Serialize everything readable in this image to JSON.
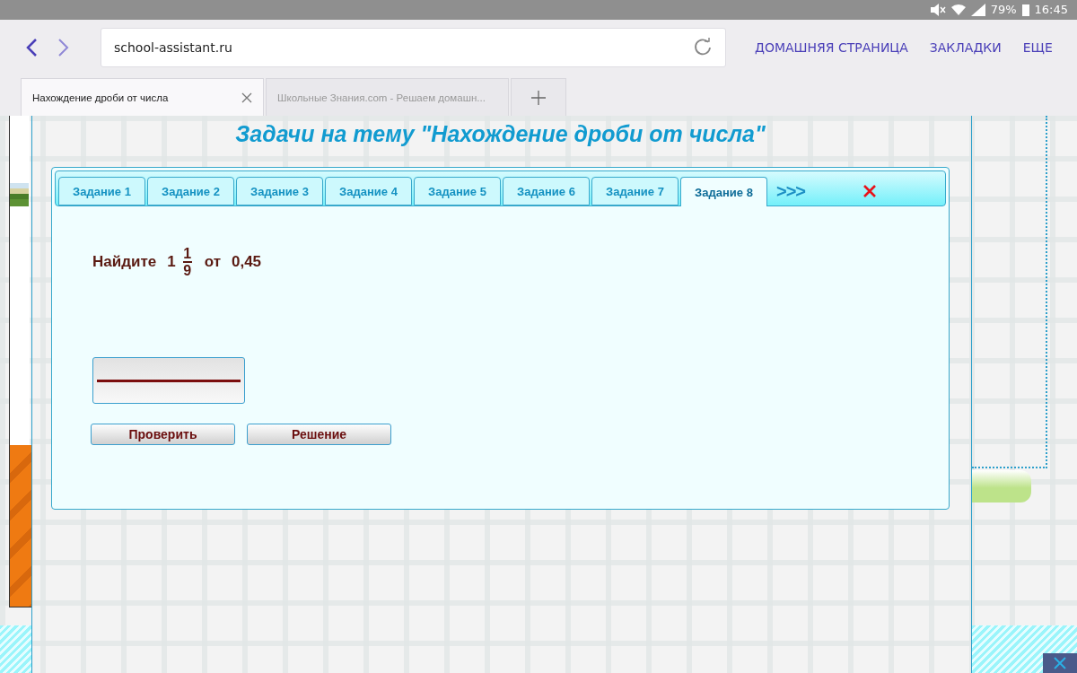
{
  "status_bar": {
    "battery": "79%",
    "time": "16:45"
  },
  "browser": {
    "url": "school-assistant.ru",
    "nav_links": [
      "ДОМАШНЯЯ СТРАНИЦА",
      "ЗАКЛАДКИ",
      "ЕЩЕ"
    ],
    "tabs": [
      {
        "title": "Нахождение дроби от числа",
        "selected": true
      },
      {
        "title": "Школьные Знания.com - Решаем домашн...",
        "selected": false
      }
    ]
  },
  "page": {
    "title": "Задачи на тему \"Нахождение дроби от числа\"",
    "task_tabs": [
      {
        "label": "Задание 1",
        "selected": false
      },
      {
        "label": "Задание 2",
        "selected": false
      },
      {
        "label": "Задание 3",
        "selected": false
      },
      {
        "label": "Задание 4",
        "selected": false
      },
      {
        "label": "Задание 5",
        "selected": false
      },
      {
        "label": "Задание 6",
        "selected": false
      },
      {
        "label": "Задание 7",
        "selected": false
      },
      {
        "label": "Задание 8",
        "selected": true
      }
    ],
    "more_label": ">>>",
    "problem": {
      "prefix": "Найдите",
      "whole": "1",
      "numerator": "1",
      "denominator": "9",
      "middle": "от",
      "value": "0,45"
    },
    "buttons": [
      "Проверить",
      "Решение"
    ]
  }
}
